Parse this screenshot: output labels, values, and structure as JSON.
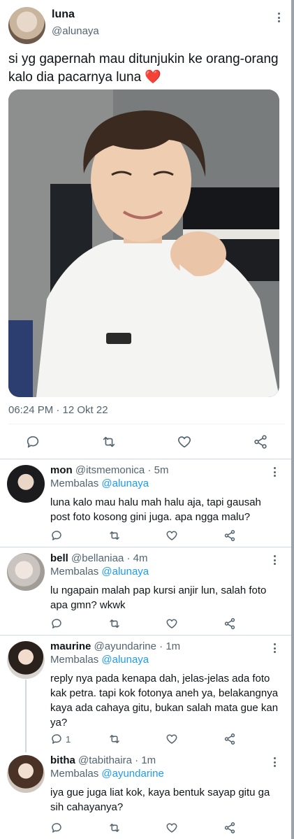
{
  "main_tweet": {
    "name": "luna",
    "handle": "@alunaya",
    "text": "si yg gapernah mau ditunjukin ke orang-orang kalo dia pacarnya luna",
    "emoji": "❤️",
    "timestamp": "06:24 PM · 12 Okt 22",
    "photo_label": "photo of a smiling person in a white t-shirt in front of a piano"
  },
  "replies": [
    {
      "name": "mon",
      "handle": "@itsmemonica",
      "time": "· 5m",
      "replying_prefix": "Membalas",
      "replying_to": "@alunaya",
      "text": "luna kalo mau halu mah halu aja, tapi gausah post foto kosong gini juga. apa ngga malu?",
      "reply_count": ""
    },
    {
      "name": "bell",
      "handle": "@bellaniaa",
      "time": "· 4m",
      "replying_prefix": "Membalas",
      "replying_to": "@alunaya",
      "text": "lu ngapain malah pap kursi anjir lun, salah foto apa gmn? wkwk",
      "reply_count": ""
    },
    {
      "name": "maurine",
      "handle": "@ayundarine",
      "time": "· 1m",
      "replying_prefix": "Membalas",
      "replying_to": "@alunaya",
      "text": "reply nya pada kenapa dah, jelas-jelas ada foto kak petra. tapi kok fotonya aneh ya, belakangnya kaya ada cahaya gitu, bukan salah mata gue kan ya?",
      "reply_count": "1"
    },
    {
      "name": "bitha",
      "handle": "@tabithaira",
      "time": "· 1m",
      "replying_prefix": "Membalas",
      "replying_to": "@ayundarine",
      "text": "iya gue juga liat kok, kaya bentuk sayap gitu ga sih cahayanya?",
      "reply_count": ""
    }
  ],
  "icons": {
    "reply": "reply-icon",
    "retweet": "retweet-icon",
    "like": "like-icon",
    "share": "share-icon",
    "more": "more-icon"
  },
  "colors": {
    "link": "#1d9bf0",
    "secondary_text": "#536471",
    "primary_text": "#0f1419",
    "heart": "#e0245e"
  }
}
